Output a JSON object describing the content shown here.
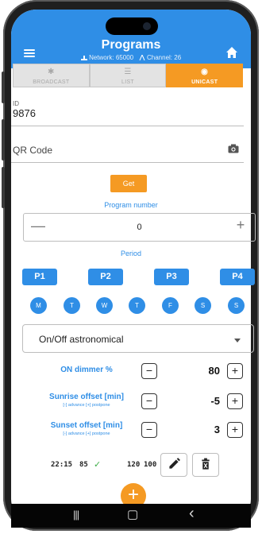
{
  "header": {
    "title": "Programs",
    "network_label": "Network: 65000",
    "channel_label": "Channel: 26"
  },
  "tabs": [
    {
      "label": "BROADCAST",
      "icon": "broadcast-icon",
      "active": false
    },
    {
      "label": "LIST",
      "icon": "list-icon",
      "active": false
    },
    {
      "label": "UNICAST",
      "icon": "target-icon",
      "active": true
    }
  ],
  "id_field": {
    "label": "ID",
    "value": "9876"
  },
  "qr_field": {
    "label": "QR Code",
    "icon": "camera-icon"
  },
  "get_button": {
    "label": "Get"
  },
  "program_number": {
    "label": "Program number",
    "value": "0",
    "minus": "—",
    "plus": "+"
  },
  "period": {
    "label": "Period",
    "buttons": [
      "P1",
      "P2",
      "P3",
      "P4"
    ]
  },
  "days": [
    "M",
    "T",
    "W",
    "T",
    "F",
    "S",
    "S"
  ],
  "mode": {
    "value": "On/Off astronomical"
  },
  "params": [
    {
      "label": "ON dimmer %",
      "hint": "",
      "value": "80"
    },
    {
      "label": "Sunrise offset [min]",
      "hint": "[-] advance [+] postpone",
      "value": "-5"
    },
    {
      "label": "Sunset offset [min]",
      "hint": "[-] advance [+] postpone",
      "value": "3"
    }
  ],
  "status": {
    "time": "22:15",
    "level": "85",
    "check": "✓",
    "counter_a": "120",
    "counter_b": "100"
  },
  "buttons": {
    "minus": "−",
    "plus": "+",
    "fab": "+"
  },
  "navbar": {
    "recent": "|||",
    "home": "▢",
    "back": "‹"
  },
  "colors": {
    "primary": "#2f8ee6",
    "accent": "#f59a23",
    "success": "#3fae49"
  }
}
